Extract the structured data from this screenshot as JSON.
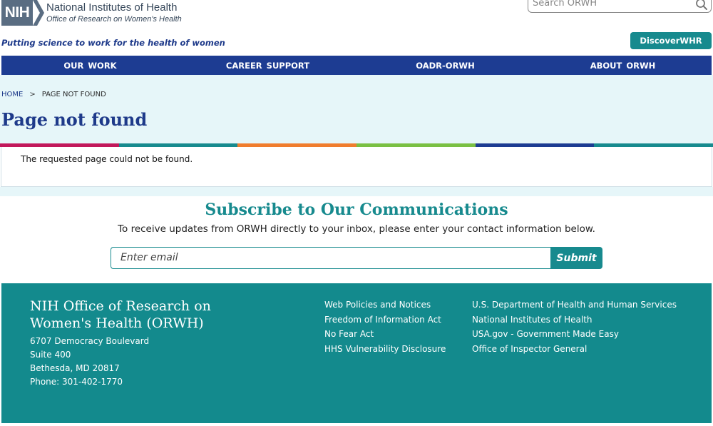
{
  "header": {
    "logo_mark": "NIH",
    "logo_title": "National Institutes of Health",
    "logo_subtitle": "Office of Research on Women's Health",
    "tagline": "Putting science to work for the health of women",
    "search_placeholder": "Search ORWH",
    "discover_label": "DiscoverWHR"
  },
  "nav": {
    "items": [
      "OUR WORK",
      "CAREER SUPPORT",
      "OADR-ORWH",
      "ABOUT ORWH"
    ]
  },
  "breadcrumb": {
    "home": "HOME",
    "separator": ">",
    "current": "PAGE NOT FOUND"
  },
  "page": {
    "title": "Page not found",
    "message": "The requested page could not be found."
  },
  "color_bar": [
    "#c2185b",
    "#178a8e",
    "#f07d2e",
    "#7ac043",
    "#1d3c92",
    "#178a8e"
  ],
  "subscribe": {
    "title": "Subscribe to Our Communications",
    "description": "To receive updates from ORWH directly to your inbox, please enter your contact information below.",
    "email_placeholder": "Enter email",
    "submit_label": "Submit"
  },
  "footer": {
    "org_line1": "NIH Office of Research on",
    "org_line2": "Women's Health (ORWH)",
    "address": [
      "6707 Democracy Boulevard",
      "Suite 400",
      "Bethesda, MD 20817",
      "Phone: 301-402-1770"
    ],
    "links_col1": [
      "Web Policies and Notices",
      "Freedom of Information Act",
      "No Fear Act",
      "HHS Vulnerability Disclosure"
    ],
    "links_col2": [
      "U.S. Department of Health and Human Services",
      "National Institutes of Health",
      "USA.gov - Government Made Easy",
      "Office of Inspector General"
    ]
  },
  "colors": {
    "nav_blue": "#1d3c92",
    "teal": "#178a8e",
    "hero_bg": "#e6f6f9"
  }
}
